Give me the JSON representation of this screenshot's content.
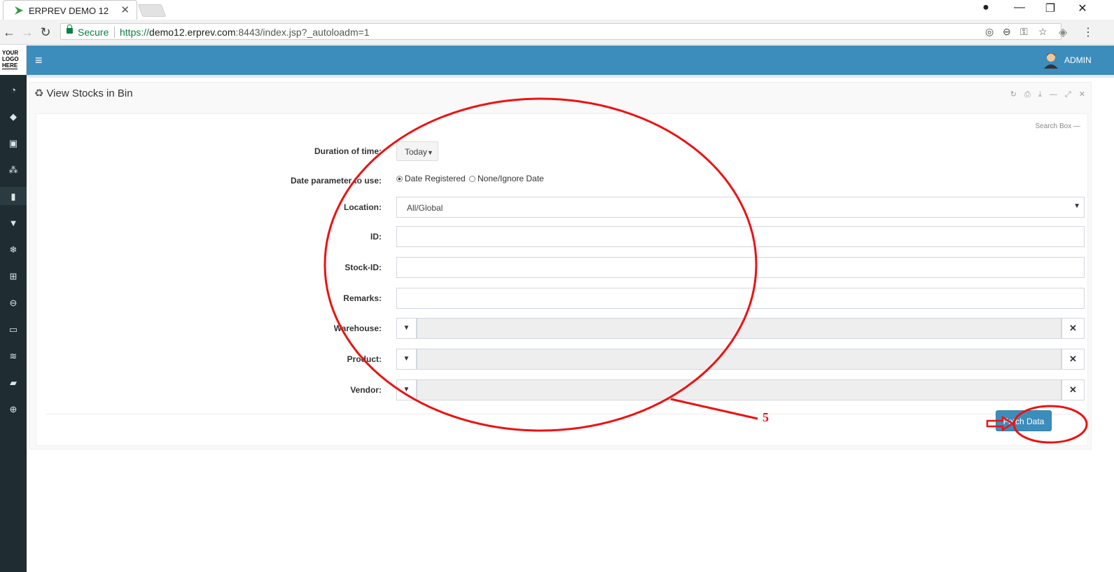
{
  "browser": {
    "tab_title": "ERPREV DEMO 12",
    "tab_close": "✕",
    "secure_label": "Secure",
    "url_scheme": "https://",
    "url_host": "demo12.erprev.com",
    "url_rest": ":8443/index.jsp?_autoloadm=1"
  },
  "sidebar": {
    "logo_lines": [
      "YOUR",
      "LOGO",
      "HERE"
    ],
    "icons": [
      "dashboard-icon",
      "tag-icon",
      "money-icon",
      "cubes-icon",
      "document-icon",
      "trash-icon",
      "snowflake-icon",
      "cart-icon",
      "circle-icon",
      "monitor-icon",
      "database-icon",
      "book-icon",
      "lifebuoy-icon"
    ]
  },
  "topbar": {
    "user_label": "ADMIN"
  },
  "panel": {
    "title": "View Stocks in Bin",
    "search_box_label": "Search Box"
  },
  "form": {
    "duration_label": "Duration of time:",
    "duration_value": "Today",
    "date_param_label": "Date parameter to use:",
    "radio_registered": "Date Registered",
    "radio_none": "None/Ignore Date",
    "location_label": "Location:",
    "location_value": "All/Global",
    "id_label": "ID:",
    "stock_id_label": "Stock-ID:",
    "remarks_label": "Remarks:",
    "warehouse_label": "Warehouse:",
    "product_label": "Product:",
    "vendor_label": "Vendor:",
    "fetch_label": "Fetch Data"
  },
  "annotation": {
    "number": "5"
  },
  "colors": {
    "brand": "#3c8dbc",
    "sidebar": "#1f2d33",
    "annotation": "#e11111"
  }
}
